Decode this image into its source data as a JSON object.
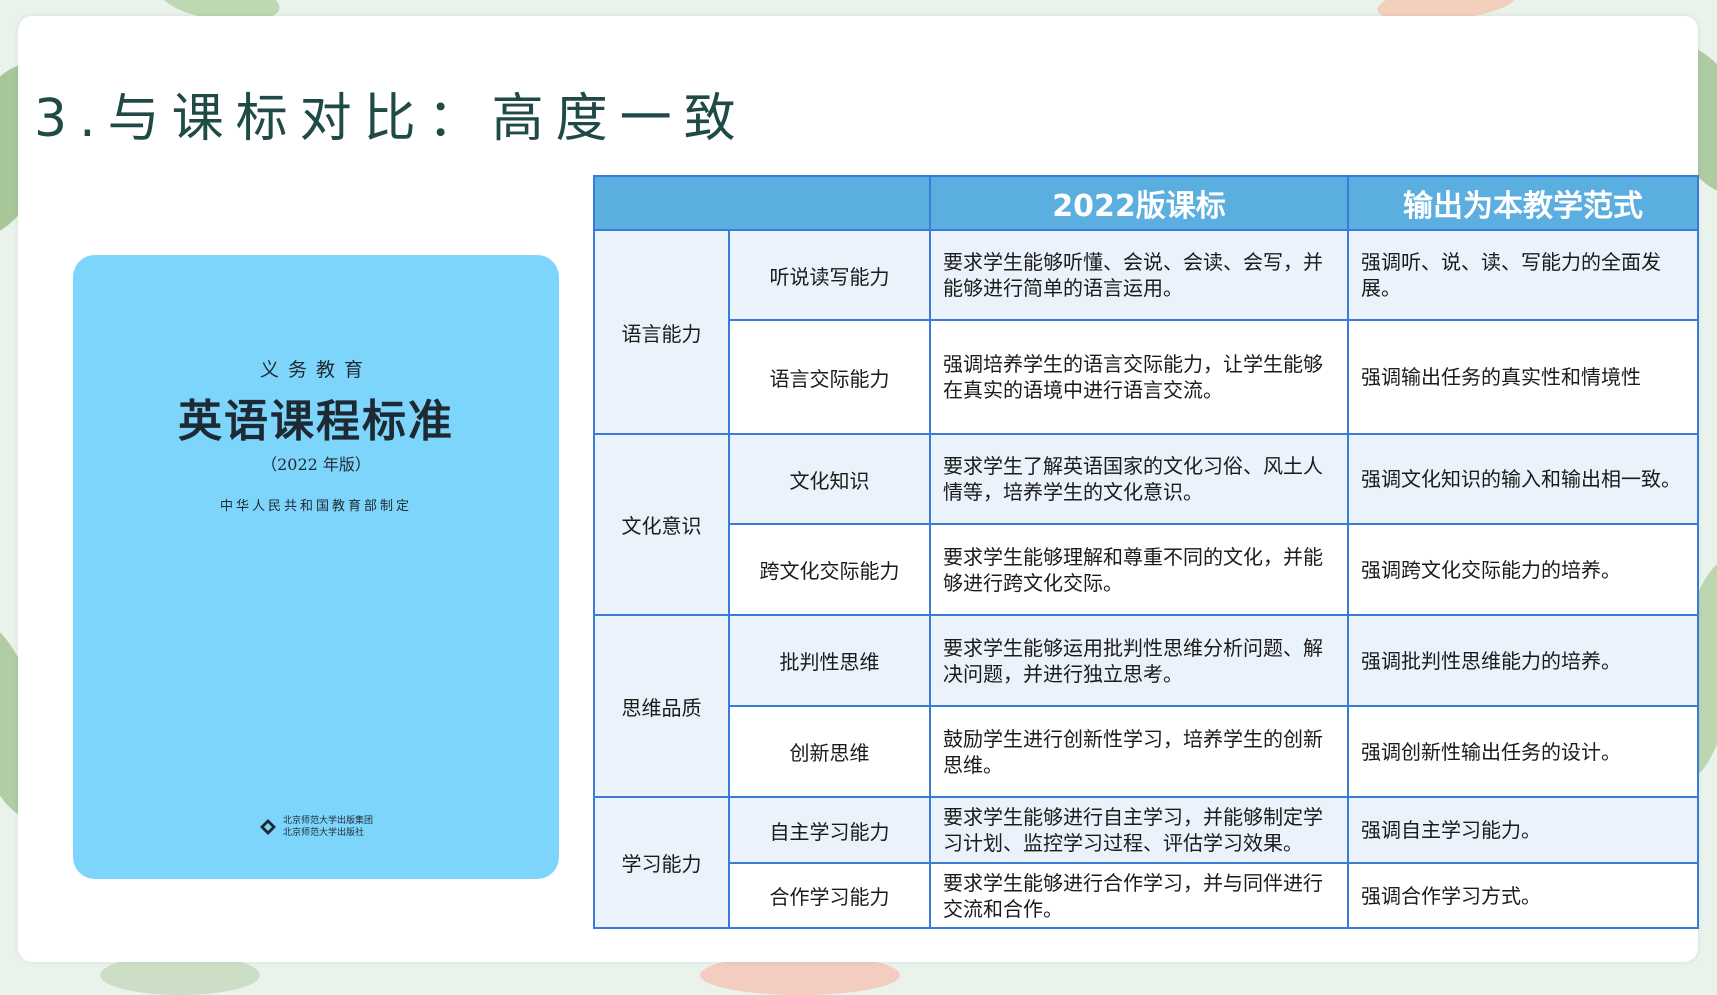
{
  "title": "3.与课标对比：高度一致",
  "book_cover": {
    "series": "义务教育",
    "title": "英语课程标准",
    "edition": "（2022 年版）",
    "author": "中华人民共和国教育部制定",
    "publisher_line1": "北京师范大学出版集团",
    "publisher_line2": "北京师范大学出版社"
  },
  "table": {
    "headers": [
      "",
      "2022版课标",
      "输出为本教学范式"
    ],
    "rows": [
      {
        "category": "语言能力",
        "sub": "听说读写能力",
        "standard": "要求学生能够听懂、会说、会读、会写，并能够进行简单的语言运用。",
        "paradigm": "强调听、说、读、写能力的全面发展。"
      },
      {
        "category": "",
        "sub": "语言交际能力",
        "standard": "强调培养学生的语言交际能力，让学生能够在真实的语境中进行语言交流。",
        "paradigm": "强调输出任务的真实性和情境性"
      },
      {
        "category": "文化意识",
        "sub": "文化知识",
        "standard": "要求学生了解英语国家的文化习俗、风土人情等，培养学生的文化意识。",
        "paradigm": "强调文化知识的输入和输出相一致。"
      },
      {
        "category": "",
        "sub": "跨文化交际能力",
        "standard": "要求学生能够理解和尊重不同的文化，并能够进行跨文化交际。",
        "paradigm": "强调跨文化交际能力的培养。"
      },
      {
        "category": "思维品质",
        "sub": "批判性思维",
        "standard": "要求学生能够运用批判性思维分析问题、解决问题，并进行独立思考。",
        "paradigm": "强调批判性思维能力的培养。"
      },
      {
        "category": "",
        "sub": "创新思维",
        "standard": "鼓励学生进行创新性学习，培养学生的创新思维。",
        "paradigm": "强调创新性输出任务的设计。"
      },
      {
        "category": "学习能力",
        "sub": "自主学习能力",
        "standard": "要求学生能够进行自主学习，并能够制定学习计划、监控学习过程、评估学习效果。",
        "paradigm": "强调自主学习能力。"
      },
      {
        "category": "",
        "sub": "合作学习能力",
        "standard": "要求学生能够进行合作学习，并与同伴进行交流和合作。",
        "paradigm": "强调合作学习方式。"
      }
    ]
  },
  "colors": {
    "header_bg": "#5aaee0",
    "border": "#3a7bd5",
    "shade_row": "#eaf3fb",
    "cover_bg": "#7ed5fb",
    "title_color": "#1f4a45"
  }
}
